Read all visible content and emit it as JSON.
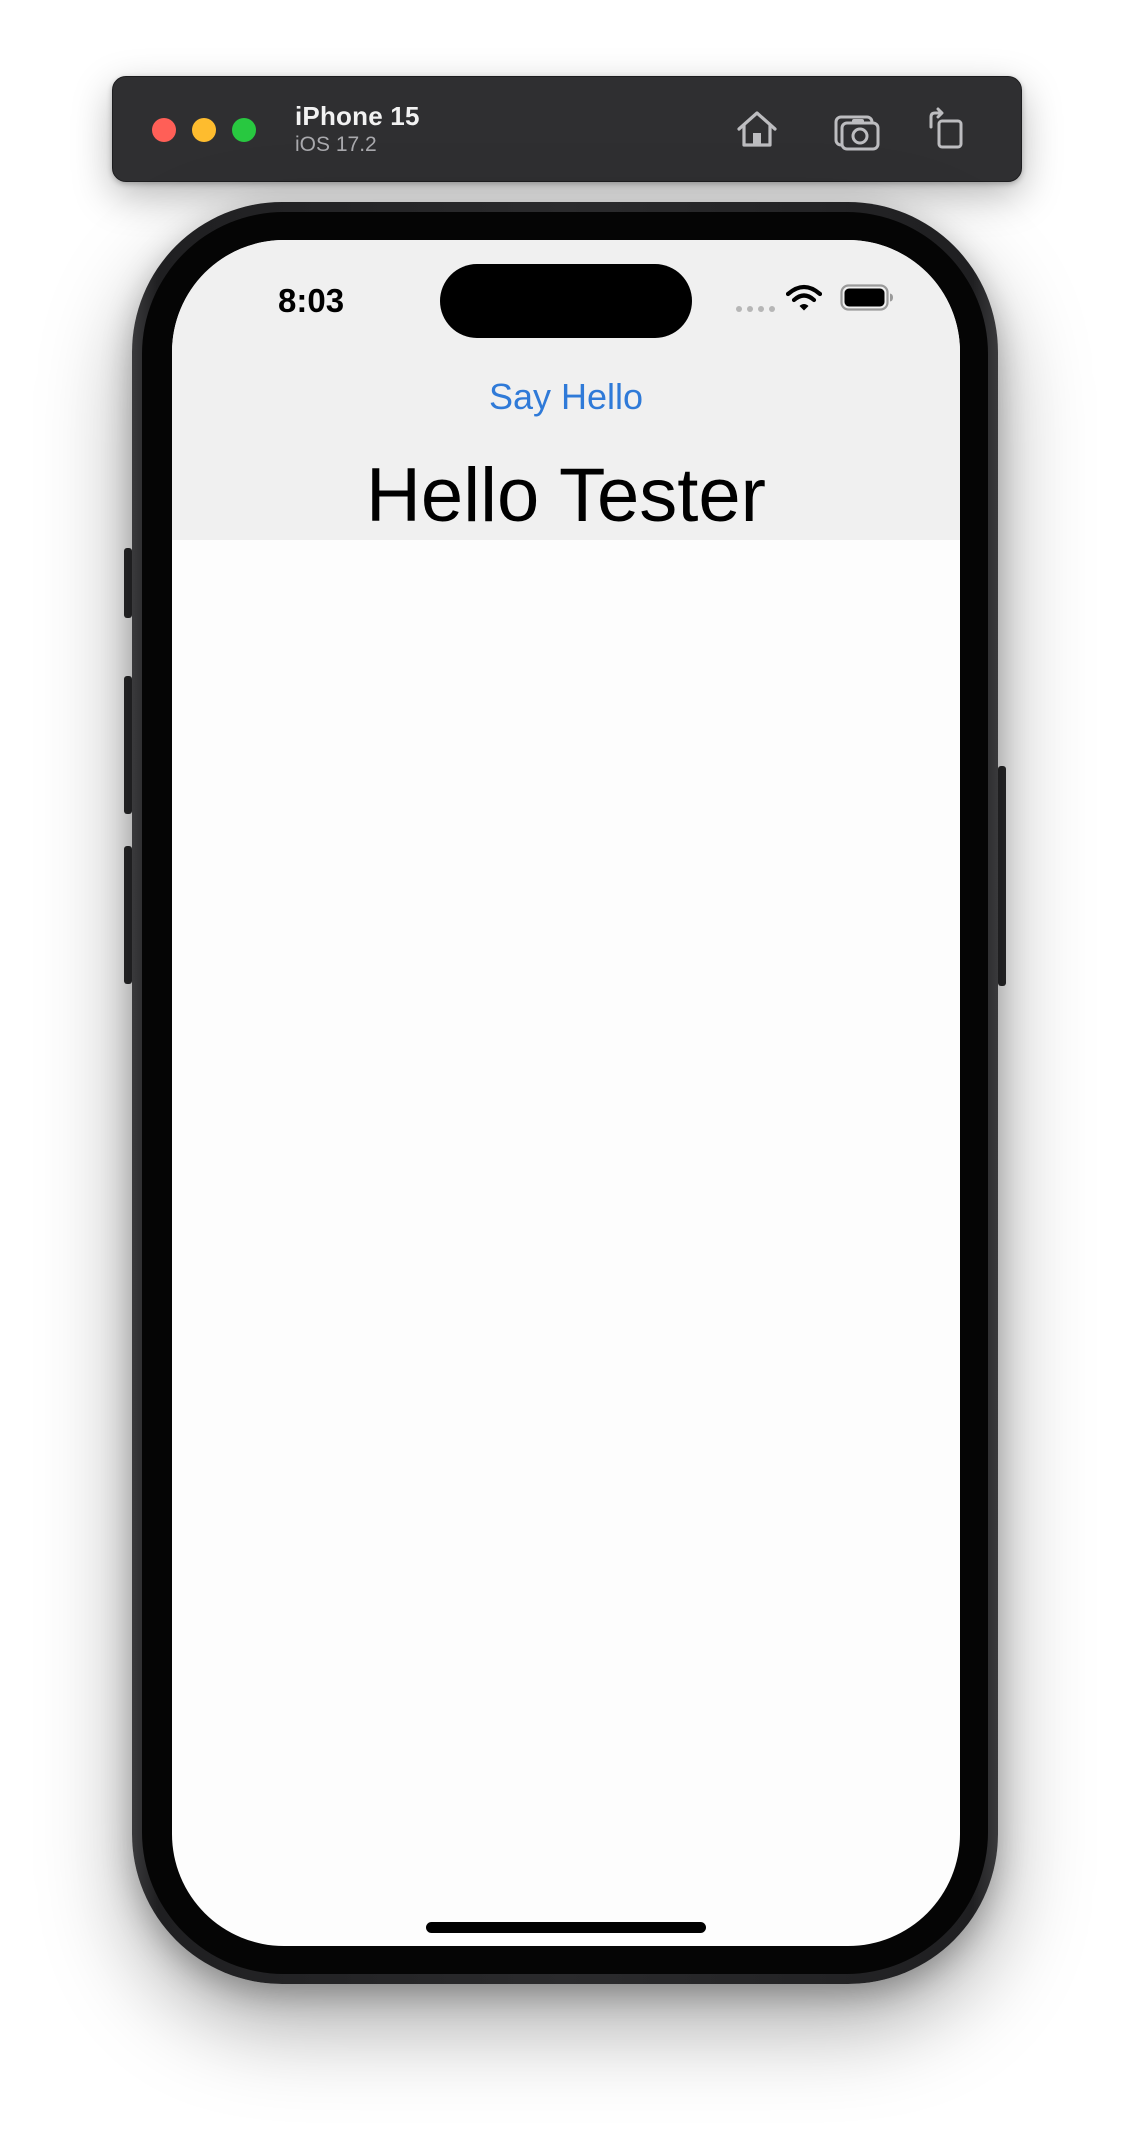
{
  "simulator": {
    "device_name": "iPhone 15",
    "os_version": "iOS 17.2",
    "toolbar_icons": [
      "home-icon",
      "screenshot-icon",
      "rotate-icon"
    ],
    "window_controls": [
      "close",
      "minimize",
      "zoom"
    ]
  },
  "status_bar": {
    "time": "8:03",
    "icons": [
      "cellular-signal-icon",
      "wifi-icon",
      "battery-icon"
    ]
  },
  "app": {
    "button_label": "Say Hello",
    "greeting_text": "Hello Tester"
  },
  "colors": {
    "accent": "#2f7ad8",
    "header_background": "#f0f0f0",
    "screen_background": "#fdfdfd",
    "toolbar_background": "#2f2f31"
  }
}
